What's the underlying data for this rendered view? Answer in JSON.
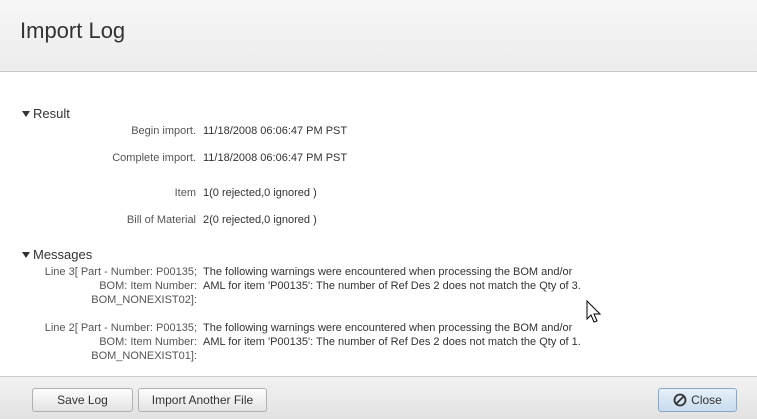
{
  "window": {
    "title": "Import Log"
  },
  "result": {
    "heading": "Result",
    "rows": [
      {
        "label": "Begin import.",
        "value": "11/18/2008 06:06:47 PM PST"
      },
      {
        "label": "Complete import.",
        "value": "11/18/2008 06:06:47 PM PST"
      },
      {
        "label": "Item",
        "value": "1(0 rejected,0 ignored )"
      },
      {
        "label": "Bill of Material",
        "value": "2(0 rejected,0 ignored )"
      }
    ]
  },
  "messages": {
    "heading": "Messages",
    "items": [
      {
        "label": {
          "line1": "Line 3[ Part - Number: P00135;",
          "line2": "BOM: Item Number:",
          "line3": "BOM_NONEXIST02]:"
        },
        "text": {
          "line1": "The following warnings were encountered when processing the BOM and/or",
          "line2": "AML for item 'P00135': The number of Ref Des 2 does not match the Qty of 3."
        }
      },
      {
        "label": {
          "line1": "Line 2[ Part - Number: P00135;",
          "line2": "BOM: Item Number:",
          "line3": "BOM_NONEXIST01]:"
        },
        "text": {
          "line1": "The following warnings were encountered when processing the BOM and/or",
          "line2": "AML for item 'P00135': The number of Ref Des 2 does not match the Qty of 1."
        }
      }
    ]
  },
  "footer": {
    "save_label": "Save Log",
    "import_label": "Import Another File",
    "close_label": "Close"
  },
  "icons": {
    "close": "cancel-circle-icon",
    "caret": "triangle-down-icon",
    "cursor": "mouse-pointer-icon"
  }
}
